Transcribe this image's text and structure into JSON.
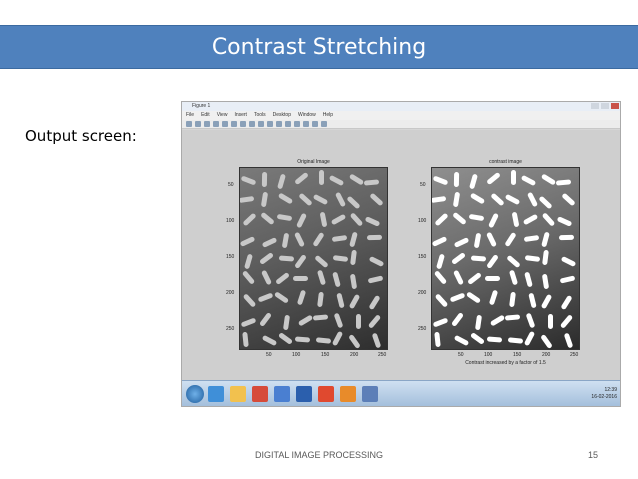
{
  "slide": {
    "title": "Contrast Stretching",
    "output_label": "Output screen:",
    "footer": "DIGITAL IMAGE PROCESSING",
    "page_number": "15"
  },
  "figure_window": {
    "title": "Figure 1",
    "menu": [
      "File",
      "Edit",
      "View",
      "Insert",
      "Tools",
      "Desktop",
      "Window",
      "Help"
    ],
    "left_axes": {
      "title": "Original Image",
      "x_ticks": [
        "50",
        "100",
        "150",
        "200",
        "250"
      ],
      "y_ticks": [
        "50",
        "100",
        "150",
        "200",
        "250"
      ]
    },
    "right_axes": {
      "title": "contrast image",
      "x_ticks": [
        "50",
        "100",
        "150",
        "200",
        "250"
      ],
      "y_ticks": [
        "50",
        "100",
        "150",
        "200",
        "250"
      ],
      "xlabel": "Contrast increased by a factor of 1.5"
    }
  },
  "taskbar": {
    "time": "12:39",
    "date": "16-02-2016",
    "icon_colors": [
      "#3f8fd8",
      "#f2c14e",
      "#d64b3a",
      "#4a7fd1",
      "#2b5fad",
      "#e0492f",
      "#e88b2a",
      "#5c7fb8"
    ]
  }
}
